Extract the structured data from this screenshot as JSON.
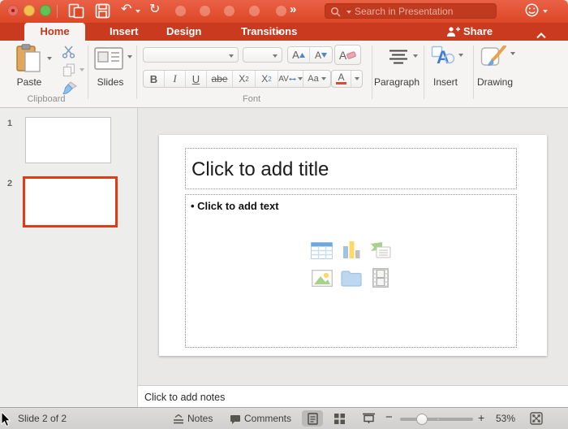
{
  "titlebar": {
    "search_placeholder": "Search in Presentation"
  },
  "tab_bar": {
    "tabs": [
      {
        "label": "Home"
      },
      {
        "label": "Insert"
      },
      {
        "label": "Design"
      },
      {
        "label": "Transitions"
      }
    ],
    "overflow": "»",
    "share_label": "Share"
  },
  "ribbon": {
    "paste": "Paste",
    "clipboard_group": "Clipboard",
    "slides": "Slides",
    "font_group": "Font",
    "bold": "B",
    "italic": "I",
    "underline": "U",
    "strikethrough": "abe",
    "superscript_base": "X",
    "superscript_exp": "2",
    "subscript_base": "X",
    "subscript_sub": "2",
    "spacing": "AV",
    "case": "Aa",
    "font_color": "A",
    "grow_font": "A",
    "shrink_font": "A",
    "clear_format": "A",
    "paragraph": "Paragraph",
    "insert": "Insert",
    "drawing": "Drawing"
  },
  "slide_panel": {
    "slides": [
      {
        "number": "1"
      },
      {
        "number": "2"
      }
    ]
  },
  "canvas": {
    "title_placeholder": "Click to add title",
    "body_placeholder": "• Click to add text"
  },
  "notes_pane": {
    "placeholder": "Click to add notes"
  },
  "status_bar": {
    "slide_indicator": "Slide 2 of 2",
    "notes": "Notes",
    "comments": "Comments",
    "zoom": "53%"
  },
  "colors": {
    "accent_red": "#dc4726",
    "selection_red": "#e23a17"
  }
}
